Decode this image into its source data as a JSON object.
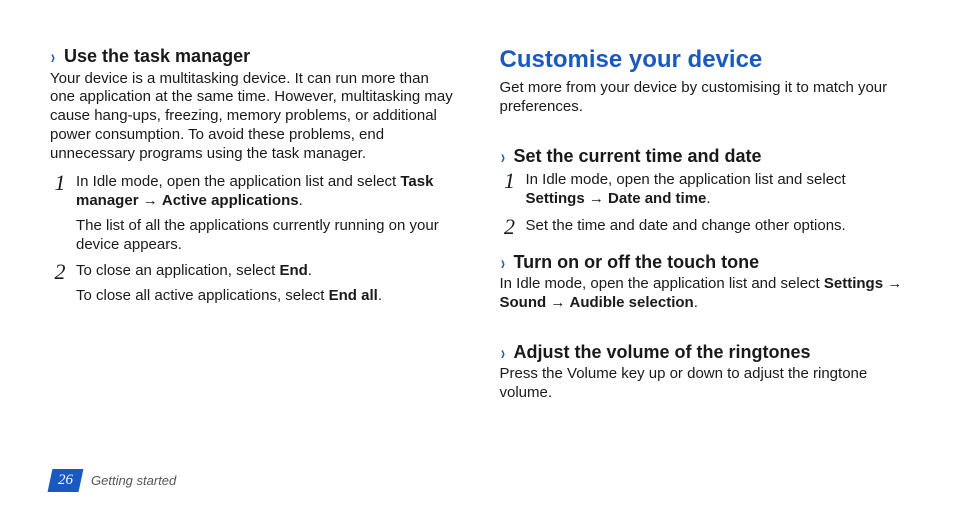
{
  "page": {
    "number": "26",
    "section": "Getting started"
  },
  "left": {
    "task_manager": {
      "heading": "Use the task manager",
      "intro": "Your device is a multitasking device. It can run more than one application at the same time. However, multitasking may cause hang-ups, freezing, memory problems, or additional power consumption. To avoid these problems, end unnecessary programs using the task manager.",
      "steps": [
        {
          "num": "1",
          "line1_pre": "In Idle mode, open the application list and select ",
          "line1_bold1": "Task manager",
          "line1_arrow": " → ",
          "line1_bold2": "Active applications",
          "line1_post": ".",
          "line2": "The list of all the applications currently running on your device appears."
        },
        {
          "num": "2",
          "line1_pre": "To close an application, select ",
          "line1_bold1": "End",
          "line1_post": ".",
          "line2_pre": "To close all active applications, select ",
          "line2_bold": "End all",
          "line2_post": "."
        }
      ]
    }
  },
  "right": {
    "customise": {
      "heading": "Customise your device",
      "intro": "Get more from your device by customising it to match your preferences."
    },
    "time_date": {
      "heading": "Set the current time and date",
      "steps": [
        {
          "num": "1",
          "pre": "In Idle mode, open the application list and select ",
          "bold1": "Settings",
          "arrow": " → ",
          "bold2": "Date and time",
          "post": "."
        },
        {
          "num": "2",
          "text": "Set the time and date and change other options."
        }
      ]
    },
    "touch_tone": {
      "heading": "Turn on or off the touch tone",
      "pre": "In Idle mode, open the application list and select ",
      "bold1": "Settings",
      "arrow1": " → ",
      "bold2": "Sound",
      "arrow2": " → ",
      "bold3": "Audible selection",
      "post": "."
    },
    "ringtone": {
      "heading": "Adjust the volume of the ringtones",
      "text": "Press the Volume key up or down to adjust the ringtone volume."
    }
  }
}
